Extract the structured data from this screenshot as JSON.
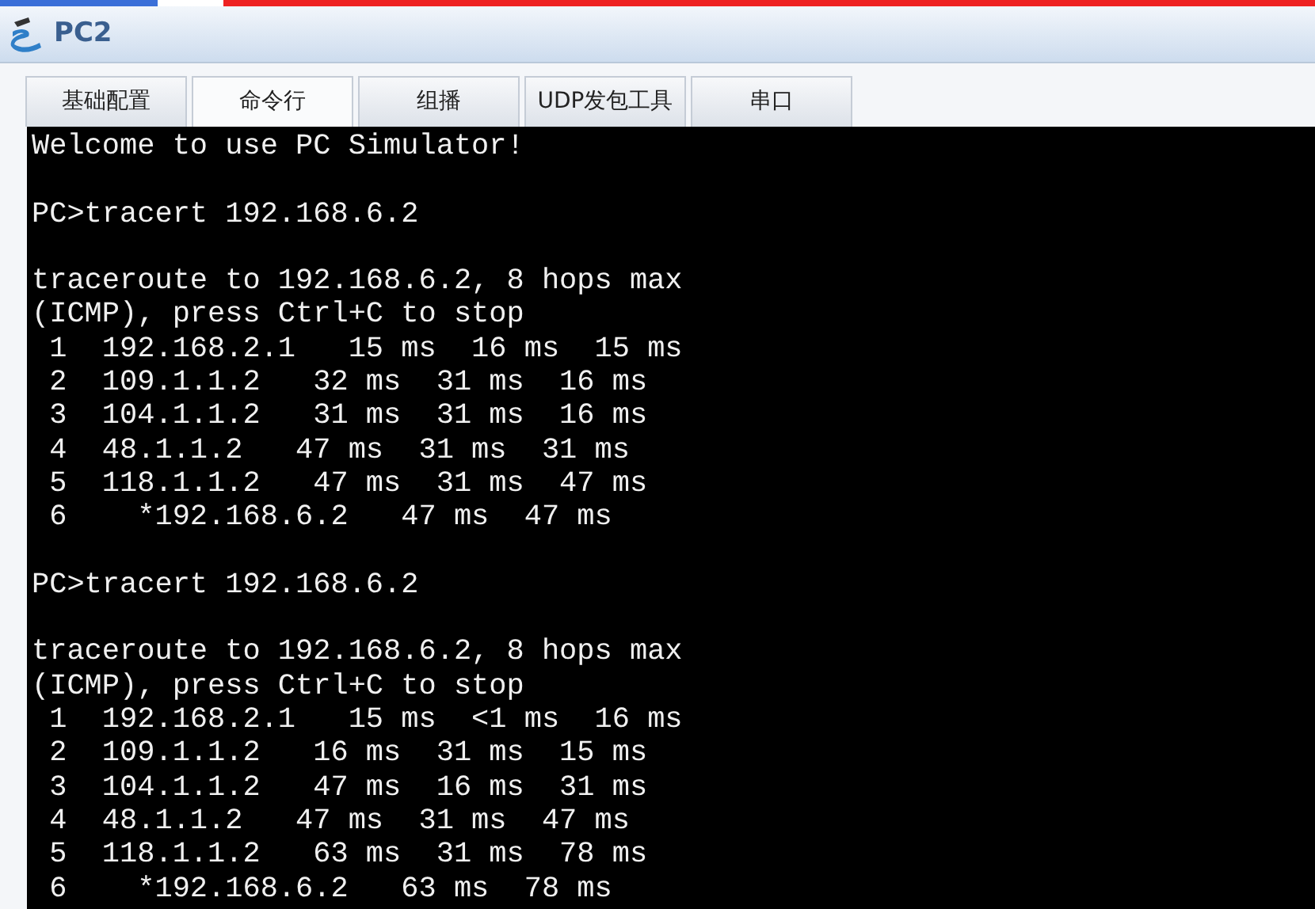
{
  "window": {
    "title": "PC2"
  },
  "tabs": [
    {
      "label": "基础配置",
      "selected": false
    },
    {
      "label": "命令行",
      "selected": true
    },
    {
      "label": "组播",
      "selected": false
    },
    {
      "label": "UDP发包工具",
      "selected": false
    },
    {
      "label": "串口",
      "selected": false
    }
  ],
  "terminal": {
    "blocks": [
      {
        "lines": [
          "Welcome to use PC Simulator!"
        ]
      },
      {
        "lines": [
          "PC>tracert 192.168.6.2"
        ]
      },
      {
        "lines": [
          "traceroute to 192.168.6.2, 8 hops max",
          "(ICMP), press Ctrl+C to stop",
          " 1  192.168.2.1   15 ms  16 ms  15 ms",
          " 2  109.1.1.2   32 ms  31 ms  16 ms",
          " 3  104.1.1.2   31 ms  31 ms  16 ms",
          " 4  48.1.1.2   47 ms  31 ms  31 ms",
          " 5  118.1.1.2   47 ms  31 ms  47 ms",
          " 6    *192.168.6.2   47 ms  47 ms"
        ]
      },
      {
        "lines": [
          "PC>tracert 192.168.6.2"
        ]
      },
      {
        "lines": [
          "traceroute to 192.168.6.2, 8 hops max",
          "(ICMP), press Ctrl+C to stop",
          " 1  192.168.2.1   15 ms  <1 ms  16 ms",
          " 2  109.1.1.2   16 ms  31 ms  15 ms",
          " 3  104.1.1.2   47 ms  16 ms  31 ms",
          " 4  48.1.1.2   47 ms  31 ms  47 ms",
          " 5  118.1.1.2   63 ms  31 ms  78 ms",
          " 6    *192.168.6.2   63 ms  78 ms"
        ]
      }
    ]
  }
}
